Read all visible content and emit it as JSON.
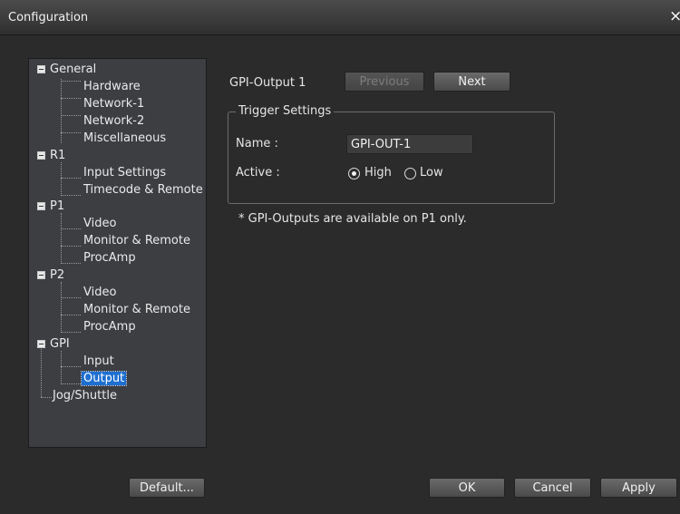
{
  "window": {
    "title": "Configuration",
    "close_glyph": "×"
  },
  "tree": {
    "general": "General",
    "general_items": [
      "Hardware",
      "Network-1",
      "Network-2",
      "Miscellaneous"
    ],
    "r1": "R1",
    "r1_items": [
      "Input Settings",
      "Timecode & Remote"
    ],
    "p1": "P1",
    "p1_items": [
      "Video",
      "Monitor & Remote",
      "ProcAmp"
    ],
    "p2": "P2",
    "p2_items": [
      "Video",
      "Monitor & Remote",
      "ProcAmp"
    ],
    "gpi": "GPI",
    "gpi_items": [
      "Input",
      "Output"
    ],
    "jog": "Jog/Shuttle",
    "selected": "Output"
  },
  "panel": {
    "heading": "GPI-Output  1",
    "previous_label": "Previous",
    "next_label": "Next",
    "trigger_group_title": "Trigger Settings",
    "name_label": "Name :",
    "name_value": "GPI-OUT-1",
    "active_label": "Active :",
    "high_label": "High",
    "low_label": "Low",
    "active_selected": "High",
    "note": "* GPI-Outputs are available on P1 only."
  },
  "footer": {
    "default_label": "Default...",
    "ok_label": "OK",
    "cancel_label": "Cancel",
    "apply_label": "Apply"
  }
}
